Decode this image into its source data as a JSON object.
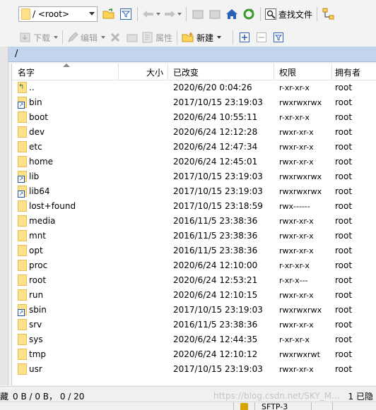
{
  "toolbar": {
    "path_value": "/ <root>",
    "find_files_label": "查找文件",
    "download_label": "下载",
    "edit_label": "编辑",
    "properties_label": "属性",
    "new_label": "新建"
  },
  "path_bar": {
    "path": "/"
  },
  "columns": {
    "name": "名字",
    "size": "大小",
    "modified": "已改变",
    "permissions": "权限",
    "owner": "拥有者"
  },
  "files": [
    {
      "name": "..",
      "date": "2020/6/20 0:04:26",
      "perm": "r-xr-xr-x",
      "owner": "root",
      "icon": "parent-folder-icon"
    },
    {
      "name": "bin",
      "date": "2017/10/15 23:19:03",
      "perm": "rwxrwxrwx",
      "owner": "root",
      "icon": "folder-link-icon"
    },
    {
      "name": "boot",
      "date": "2020/6/24 10:55:11",
      "perm": "r-xr-xr-x",
      "owner": "root",
      "icon": "folder-icon"
    },
    {
      "name": "dev",
      "date": "2020/6/24 12:12:28",
      "perm": "rwxr-xr-x",
      "owner": "root",
      "icon": "folder-icon"
    },
    {
      "name": "etc",
      "date": "2020/6/24 12:47:34",
      "perm": "rwxr-xr-x",
      "owner": "root",
      "icon": "folder-icon"
    },
    {
      "name": "home",
      "date": "2020/6/24 12:45:01",
      "perm": "rwxr-xr-x",
      "owner": "root",
      "icon": "folder-icon"
    },
    {
      "name": "lib",
      "date": "2017/10/15 23:19:03",
      "perm": "rwxrwxrwx",
      "owner": "root",
      "icon": "folder-link-icon"
    },
    {
      "name": "lib64",
      "date": "2017/10/15 23:19:03",
      "perm": "rwxrwxrwx",
      "owner": "root",
      "icon": "folder-link-icon"
    },
    {
      "name": "lost+found",
      "date": "2017/10/15 23:18:59",
      "perm": "rwx------",
      "owner": "root",
      "icon": "folder-icon"
    },
    {
      "name": "media",
      "date": "2016/11/5 23:38:36",
      "perm": "rwxr-xr-x",
      "owner": "root",
      "icon": "folder-icon"
    },
    {
      "name": "mnt",
      "date": "2016/11/5 23:38:36",
      "perm": "rwxr-xr-x",
      "owner": "root",
      "icon": "folder-icon"
    },
    {
      "name": "opt",
      "date": "2016/11/5 23:38:36",
      "perm": "rwxr-xr-x",
      "owner": "root",
      "icon": "folder-icon"
    },
    {
      "name": "proc",
      "date": "2020/6/24 12:10:00",
      "perm": "r-xr-xr-x",
      "owner": "root",
      "icon": "folder-icon"
    },
    {
      "name": "root",
      "date": "2020/6/24 12:53:21",
      "perm": "r-xr-x---",
      "owner": "root",
      "icon": "folder-icon"
    },
    {
      "name": "run",
      "date": "2020/6/24 12:10:15",
      "perm": "rwxr-xr-x",
      "owner": "root",
      "icon": "folder-icon"
    },
    {
      "name": "sbin",
      "date": "2017/10/15 23:19:03",
      "perm": "rwxrwxrwx",
      "owner": "root",
      "icon": "folder-link-icon"
    },
    {
      "name": "srv",
      "date": "2016/11/5 23:38:36",
      "perm": "rwxr-xr-x",
      "owner": "root",
      "icon": "folder-icon"
    },
    {
      "name": "sys",
      "date": "2020/6/24 12:44:35",
      "perm": "r-xr-xr-x",
      "owner": "root",
      "icon": "folder-icon"
    },
    {
      "name": "tmp",
      "date": "2020/6/24 12:10:12",
      "perm": "rwxrwxrwt",
      "owner": "root",
      "icon": "folder-icon"
    },
    {
      "name": "usr",
      "date": "2017/10/15 23:19:03",
      "perm": "rwxr-xr-x",
      "owner": "root",
      "icon": "folder-icon"
    }
  ],
  "status": {
    "left_fragment": "藏",
    "selection": "0 B / 0 B，  0 / 20",
    "right_fragment": "1 已隐",
    "protocol": "SFTP-3",
    "watermark": "https://blog.csdn.net/SKY_M..."
  },
  "colors": {
    "path_bar_bg": "#c3d5ec",
    "folder": "#ffe08a",
    "green_icon": "#3a9a2a",
    "blue_icon": "#2a62b8"
  }
}
